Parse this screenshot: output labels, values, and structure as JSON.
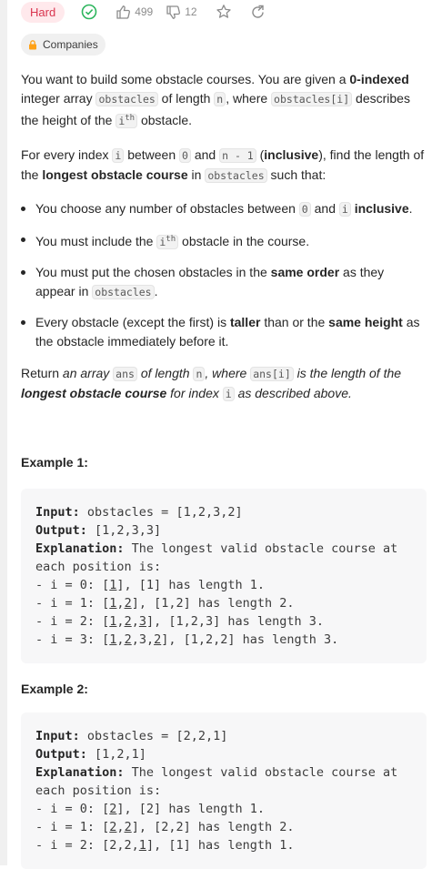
{
  "header": {
    "difficulty": "Hard",
    "likes": "499",
    "dislikes": "12",
    "companies_label": "Companies"
  },
  "description": {
    "p1_a": "You want to build some obstacle courses. You are given a ",
    "p1_b": "0-indexed",
    "p1_c": " integer array ",
    "p1_code1": "obstacles",
    "p1_d": " of length ",
    "p1_code2": "n",
    "p1_e": ", where ",
    "p1_code3": "obstacles[i]",
    "p1_f": " describes the height of the ",
    "p1_code4": "i",
    "p1_sup": "th",
    "p1_g": " obstacle.",
    "p2_a": "For every index ",
    "p2_code1": "i",
    "p2_b": " between ",
    "p2_code2": "0",
    "p2_c": " and ",
    "p2_code3": "n - 1",
    "p2_d": " (",
    "p2_bold1": "inclusive",
    "p2_e": "), find the length of the ",
    "p2_bold2": "longest obstacle course",
    "p2_f": " in ",
    "p2_code4": "obstacles",
    "p2_g": " such that:",
    "b1_a": "You choose any number of obstacles between ",
    "b1_code1": "0",
    "b1_b": " and ",
    "b1_code2": "i",
    "b1_bold": "inclusive",
    "b1_c": ".",
    "b2_a": "You must include the ",
    "b2_code": "i",
    "b2_sup": "th",
    "b2_b": " obstacle in the course.",
    "b3_a": "You must put the chosen obstacles in the ",
    "b3_bold": "same order",
    "b3_b": " as they appear in ",
    "b3_code": "obstacles",
    "b3_c": ".",
    "b4_a": "Every obstacle (except the first) is ",
    "b4_bold1": "taller",
    "b4_b": " than or the ",
    "b4_bold2": "same height",
    "b4_c": " as the obstacle immediately before it.",
    "p3_a": "Return ",
    "p3_i1": "an array ",
    "p3_code1": "ans",
    "p3_i2": " of length ",
    "p3_code2": "n",
    "p3_i3": ", where ",
    "p3_code3": "ans[i]",
    "p3_i4": " is the length of the ",
    "p3_bold": "longest obstacle course",
    "p3_i5": " for index ",
    "p3_code4": "i",
    "p3_i6": " as described above."
  },
  "examples": [
    {
      "title": "Example 1:",
      "input_label": "Input:",
      "input": " obstacles = [1,2,3,2]",
      "output_label": "Output:",
      "output": " [1,2,3,3]",
      "explanation_label": "Explanation:",
      "explanation": " The longest valid obstacle course at\neach position is:",
      "lines": [
        "- i = 0: [1], [1] has length 1.",
        "- i = 1: [1,2], [1,2] has length 2.",
        "- i = 2: [1,2,3], [1,2,3] has length 3.",
        "- i = 3: [1,2,3,2], [1,2,2] has length 3."
      ]
    },
    {
      "title": "Example 2:",
      "input_label": "Input:",
      "input": " obstacles = [2,2,1]",
      "output_label": "Output:",
      "output": " [1,2,1]",
      "explanation_label": "Explanation:",
      "explanation": " The longest valid obstacle course at\neach position is:",
      "lines": [
        "- i = 0: [2], [2] has length 1.",
        "- i = 1: [2,2], [2,2] has length 2.",
        "- i = 2: [2,2,1], [1] has length 1."
      ]
    }
  ]
}
